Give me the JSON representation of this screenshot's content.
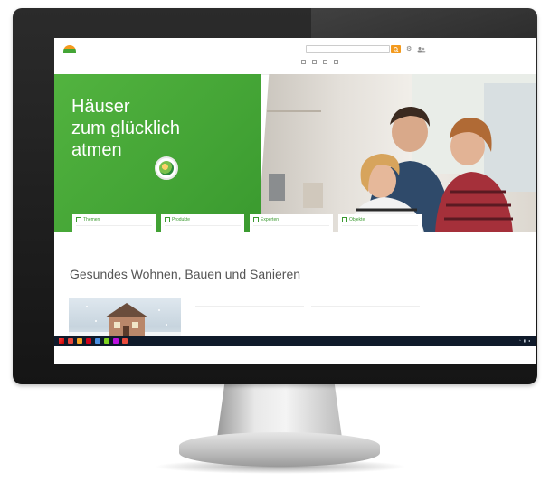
{
  "site": {
    "logo_line1": "",
    "logo_line2": "",
    "nav": [
      "",
      "",
      "",
      ""
    ],
    "search_placeholder": "",
    "quicklinks": [
      "",
      "",
      "",
      ""
    ]
  },
  "hero": {
    "headline_line1": "Häuser",
    "headline_line2": "zum glücklich",
    "headline_line3": "atmen",
    "tiles": [
      {
        "title": "Themen",
        "icon": "document-icon",
        "desc": ""
      },
      {
        "title": "Produkte",
        "icon": "grid-icon",
        "desc": ""
      },
      {
        "title": "Experten",
        "icon": "people-icon",
        "desc": ""
      },
      {
        "title": "Objekte",
        "icon": "house-icon",
        "desc": ""
      }
    ]
  },
  "main": {
    "section_title": "Gesundes Wohnen, Bauen und Sanieren",
    "col1": [
      "",
      ""
    ],
    "col2": [
      "",
      ""
    ]
  },
  "taskbar": {
    "time": "",
    "date": ""
  },
  "colors": {
    "brand_green": "#3a9a2f",
    "brand_orange": "#f39a1e",
    "taskbar": "#0f1a2a"
  }
}
